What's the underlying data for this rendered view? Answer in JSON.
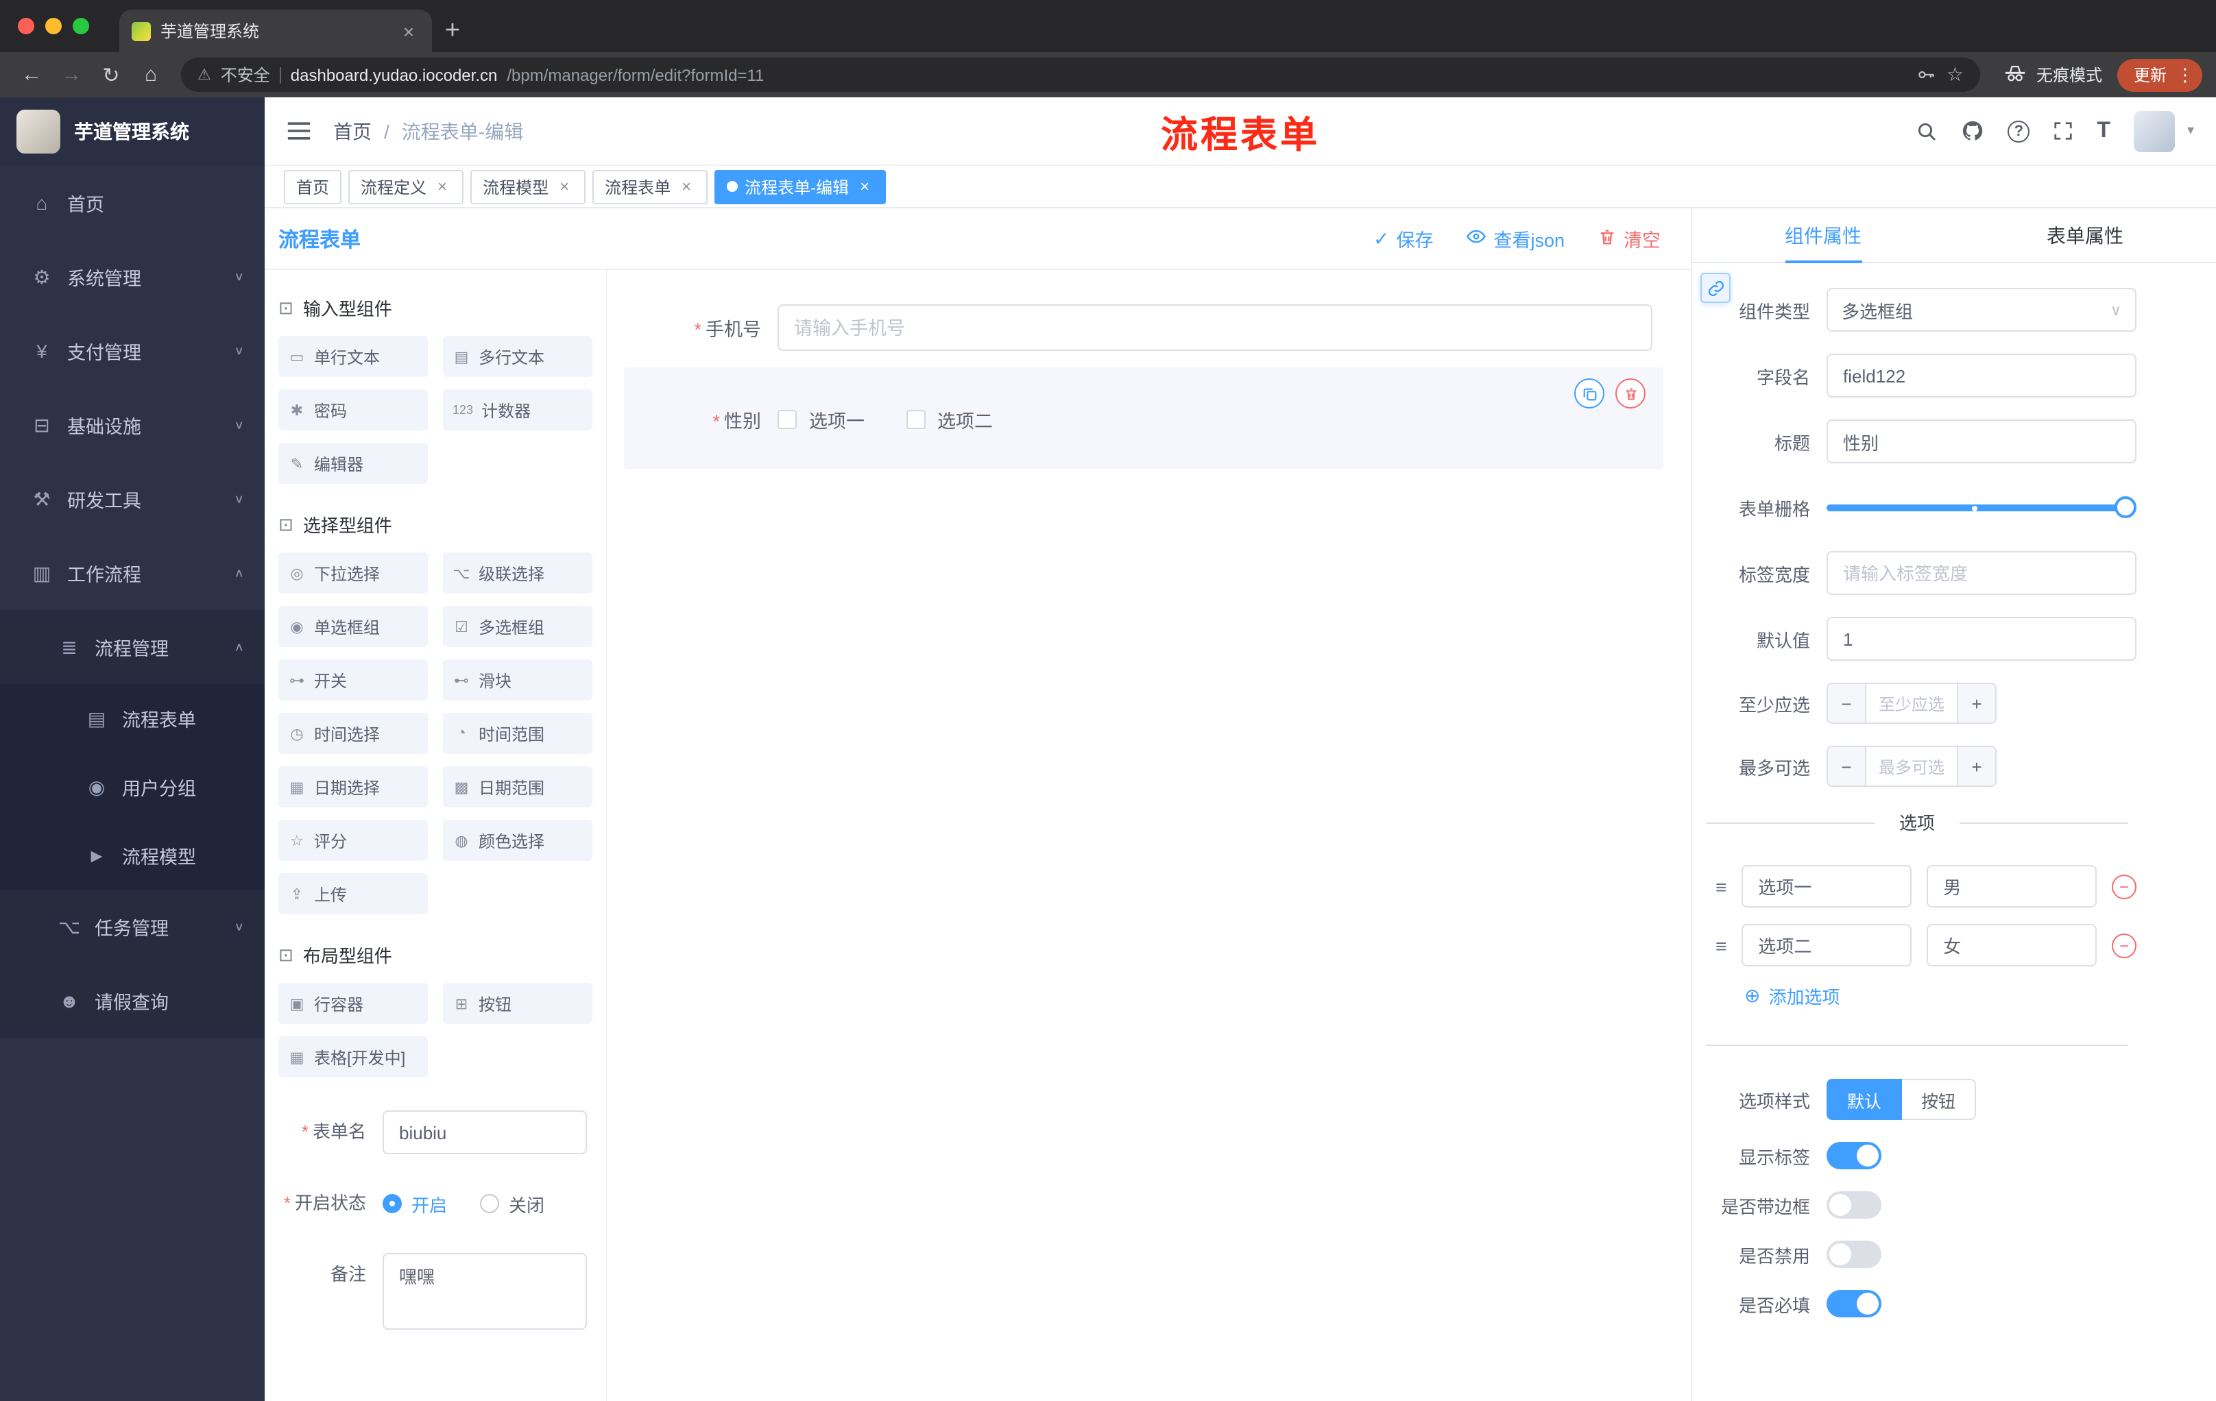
{
  "colors": {
    "accent": "#409EFF",
    "danger": "#F56C6C",
    "annotation_red": "#FB2B16",
    "sidebar_bg": "#2D3248",
    "update_pill": "#C14E33"
  },
  "glyphs": {
    "close": "×",
    "plus": "+",
    "minus": "−",
    "kebab": "⋮",
    "chevron_down": "∨",
    "chevron_up": "∧",
    "caret_down": "▾",
    "back": "←",
    "forward": "→",
    "reload": "↻",
    "home": "⌂",
    "warning": "⚠",
    "star_bookmark": "☆",
    "star": "*",
    "check": "✓",
    "add": "⊕",
    "drag": "≡",
    "dot": "●"
  },
  "browser": {
    "tab_title": "芋道管理系统",
    "security_label": "不安全",
    "url_host": "dashboard.yudao.iocoder.cn",
    "url_path": "/bpm/manager/form/edit?formId=11",
    "incognito_label": "无痕模式",
    "update_label": "更新"
  },
  "sidebar": {
    "logo_title": "芋道管理系统",
    "items": [
      {
        "icon": "⌂",
        "label": "首页",
        "chevron": ""
      },
      {
        "icon": "⚙",
        "label": "系统管理",
        "chevron": "∨"
      },
      {
        "icon": "¥",
        "label": "支付管理",
        "chevron": "∨"
      },
      {
        "icon": "⊟",
        "label": "基础设施",
        "chevron": "∨"
      },
      {
        "icon": "⚒",
        "label": "研发工具",
        "chevron": "∨"
      },
      {
        "icon": "▥",
        "label": "工作流程",
        "chevron": "∧"
      },
      {
        "icon": "≣",
        "label": "流程管理",
        "chevron": "∧"
      },
      {
        "icon": "▤",
        "label": "流程表单",
        "chevron": ""
      },
      {
        "icon": "◉",
        "label": "用户分组",
        "chevron": ""
      },
      {
        "icon": "►",
        "label": "流程模型",
        "chevron": ""
      },
      {
        "icon": "⌥",
        "label": "任务管理",
        "chevron": "∨"
      },
      {
        "icon": "☻",
        "label": "请假查询",
        "chevron": ""
      }
    ]
  },
  "header": {
    "breadcrumb_home": "首页",
    "breadcrumb_sep": "/",
    "breadcrumb_current": "流程表单-编辑",
    "annotation": "流程表单"
  },
  "tags": [
    {
      "label": "首页"
    },
    {
      "label": "流程定义"
    },
    {
      "label": "流程模型"
    },
    {
      "label": "流程表单"
    },
    {
      "label": "流程表单-编辑"
    }
  ],
  "designer": {
    "title": "流程表单",
    "save_label": "保存",
    "view_json_label": "查看json",
    "clear_label": "清空",
    "palette": {
      "group_icon": "⊡",
      "groups": [
        {
          "title": "输入型组件",
          "items": [
            {
              "icon": "▭",
              "label": "单行文本"
            },
            {
              "icon": "▤",
              "label": "多行文本"
            },
            {
              "icon": "✱",
              "label": "密码"
            },
            {
              "icon": "123",
              "label": "计数器"
            },
            {
              "icon": "✎",
              "label": "编辑器"
            }
          ]
        },
        {
          "title": "选择型组件",
          "items": [
            {
              "icon": "◎",
              "label": "下拉选择"
            },
            {
              "icon": "⌥",
              "label": "级联选择"
            },
            {
              "icon": "◉",
              "label": "单选框组"
            },
            {
              "icon": "☑",
              "label": "多选框组"
            },
            {
              "icon": "⊶",
              "label": "开关"
            },
            {
              "icon": "⊷",
              "label": "滑块"
            },
            {
              "icon": "◷",
              "label": "时间选择"
            },
            {
              "icon": "◔",
              "label": "时间范围"
            },
            {
              "icon": "▦",
              "label": "日期选择"
            },
            {
              "icon": "▩",
              "label": "日期范围"
            },
            {
              "icon": "☆",
              "label": "评分"
            },
            {
              "icon": "◍",
              "label": "颜色选择"
            },
            {
              "icon": "⇪",
              "label": "上传"
            }
          ]
        },
        {
          "title": "布局型组件",
          "items": [
            {
              "icon": "▣",
              "label": "行容器"
            },
            {
              "icon": "⊞",
              "label": "按钮"
            },
            {
              "icon": "▦",
              "label": "表格[开发中]"
            }
          ]
        }
      ]
    },
    "meta": {
      "form_name_label": "表单名",
      "form_name_value": "biubiu",
      "status_label": "开启状态",
      "status_on": "开启",
      "status_off": "关闭",
      "remark_label": "备注",
      "remark_value": "嘿嘿"
    },
    "canvas": {
      "phone_label": "手机号",
      "phone_placeholder": "请输入手机号",
      "gender_label": "性别",
      "gender_options": [
        "选项一",
        "选项二"
      ]
    }
  },
  "props": {
    "tab_component": "组件属性",
    "tab_form": "表单属性",
    "rows": {
      "component_type_label": "组件类型",
      "component_type_value": "多选框组",
      "field_name_label": "字段名",
      "field_name_value": "field122",
      "title_label": "标题",
      "title_value": "性别",
      "grid_label": "表单栅格",
      "label_width_label": "标签宽度",
      "label_width_placeholder": "请输入标签宽度",
      "default_label": "默认值",
      "default_value": "1",
      "min_label": "至少应选",
      "min_placeholder": "至少应选",
      "max_label": "最多可选",
      "max_placeholder": "最多可选"
    },
    "options": {
      "divider_title": "选项",
      "items": [
        {
          "label": "选项一",
          "value": "男"
        },
        {
          "label": "选项二",
          "value": "女"
        }
      ],
      "add_label": "添加选项"
    },
    "style": {
      "label": "选项样式",
      "choices": [
        "默认",
        "按钮"
      ],
      "selected": "默认"
    },
    "switches": [
      {
        "label": "显示标签",
        "on": true
      },
      {
        "label": "是否带边框",
        "on": false
      },
      {
        "label": "是否禁用",
        "on": false
      },
      {
        "label": "是否必填",
        "on": true
      }
    ]
  }
}
